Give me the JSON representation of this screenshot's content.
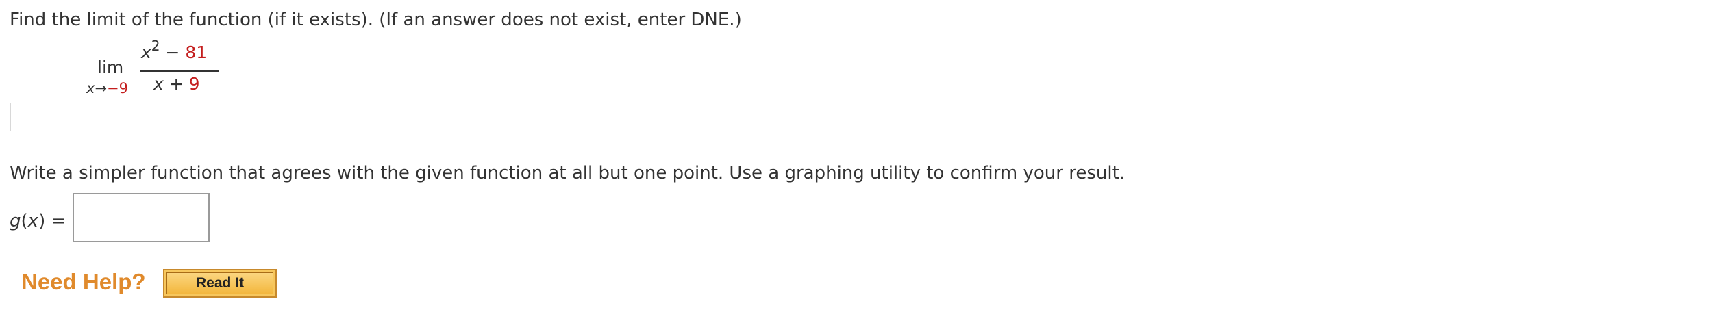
{
  "question": {
    "text": "Find the limit of the function (if it exists). (If an answer does not exist, enter DNE.)"
  },
  "limit": {
    "lim_word": "lim",
    "sub_var": "x",
    "sub_arrow": "→",
    "sub_value": "−9",
    "numerator_var": "x",
    "numerator_exp": "2",
    "numerator_op": " − ",
    "numerator_const": "81",
    "denominator_var": "x",
    "denominator_op": " + ",
    "denominator_const": "9"
  },
  "answer1": {
    "value": ""
  },
  "instruction": {
    "text": "Write a simpler function that agrees with the given function at all but one point. Use a graphing utility to confirm your result."
  },
  "g_function": {
    "name": "g",
    "open": "(",
    "var": "x",
    "close": ")",
    "equals": " =",
    "value": ""
  },
  "help": {
    "label": "Need Help?",
    "read_it_label": "Read It"
  },
  "colors": {
    "highlight": "#c41e1e",
    "help_orange": "#e08a2c",
    "button_fill": "#f7c75d"
  }
}
